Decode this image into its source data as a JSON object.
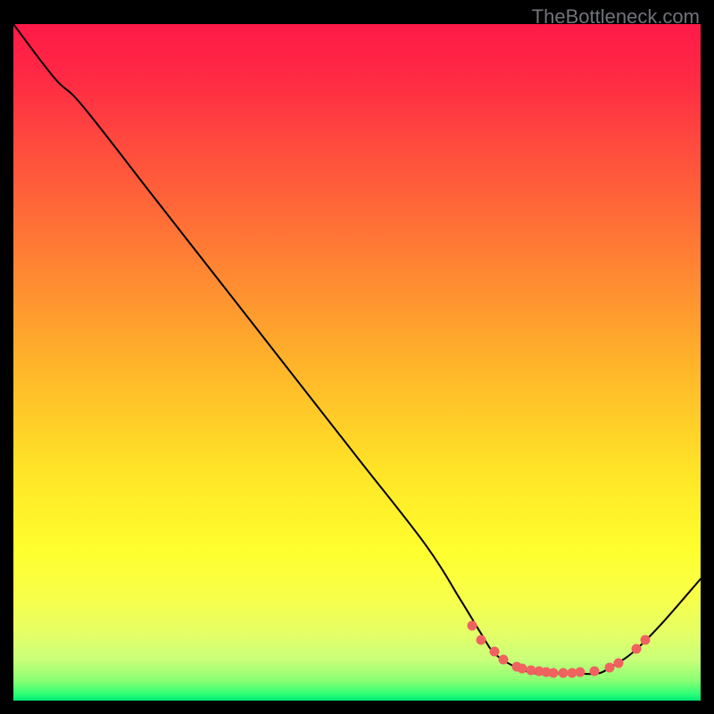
{
  "watermark": "TheBottleneck.com",
  "gradient": {
    "top": "#ff1a48",
    "mid": "#ffe427",
    "bottom": "#00e874"
  },
  "chart_data": {
    "type": "line",
    "title": "",
    "xlabel": "",
    "ylabel": "",
    "xlim": [
      0,
      100
    ],
    "ylim": [
      0,
      100
    ],
    "series": [
      {
        "name": "bottleneck-curve",
        "x": [
          0,
          6,
          10,
          20,
          30,
          40,
          50,
          60,
          65,
          68,
          70,
          73,
          76,
          79,
          82,
          85,
          87,
          90,
          94,
          100
        ],
        "y": [
          100,
          92,
          88,
          75,
          62,
          49,
          36,
          23,
          15,
          10,
          7,
          5,
          4,
          4,
          4,
          4,
          5,
          7,
          11,
          18
        ]
      }
    ],
    "markers": {
      "name": "highlight-dots",
      "x": [
        66.7,
        68.0,
        70.0,
        71.3,
        73.3,
        74.0,
        75.3,
        76.5,
        77.5,
        78.6,
        80.0,
        81.3,
        82.5,
        84.6,
        86.7,
        88.0,
        90.7,
        91.9
      ],
      "y": [
        11.1,
        9.0,
        7.2,
        6.1,
        5.0,
        4.75,
        4.5,
        4.3,
        4.2,
        4.15,
        4.1,
        4.1,
        4.2,
        4.4,
        4.9,
        5.5,
        7.6,
        9.0
      ]
    }
  }
}
